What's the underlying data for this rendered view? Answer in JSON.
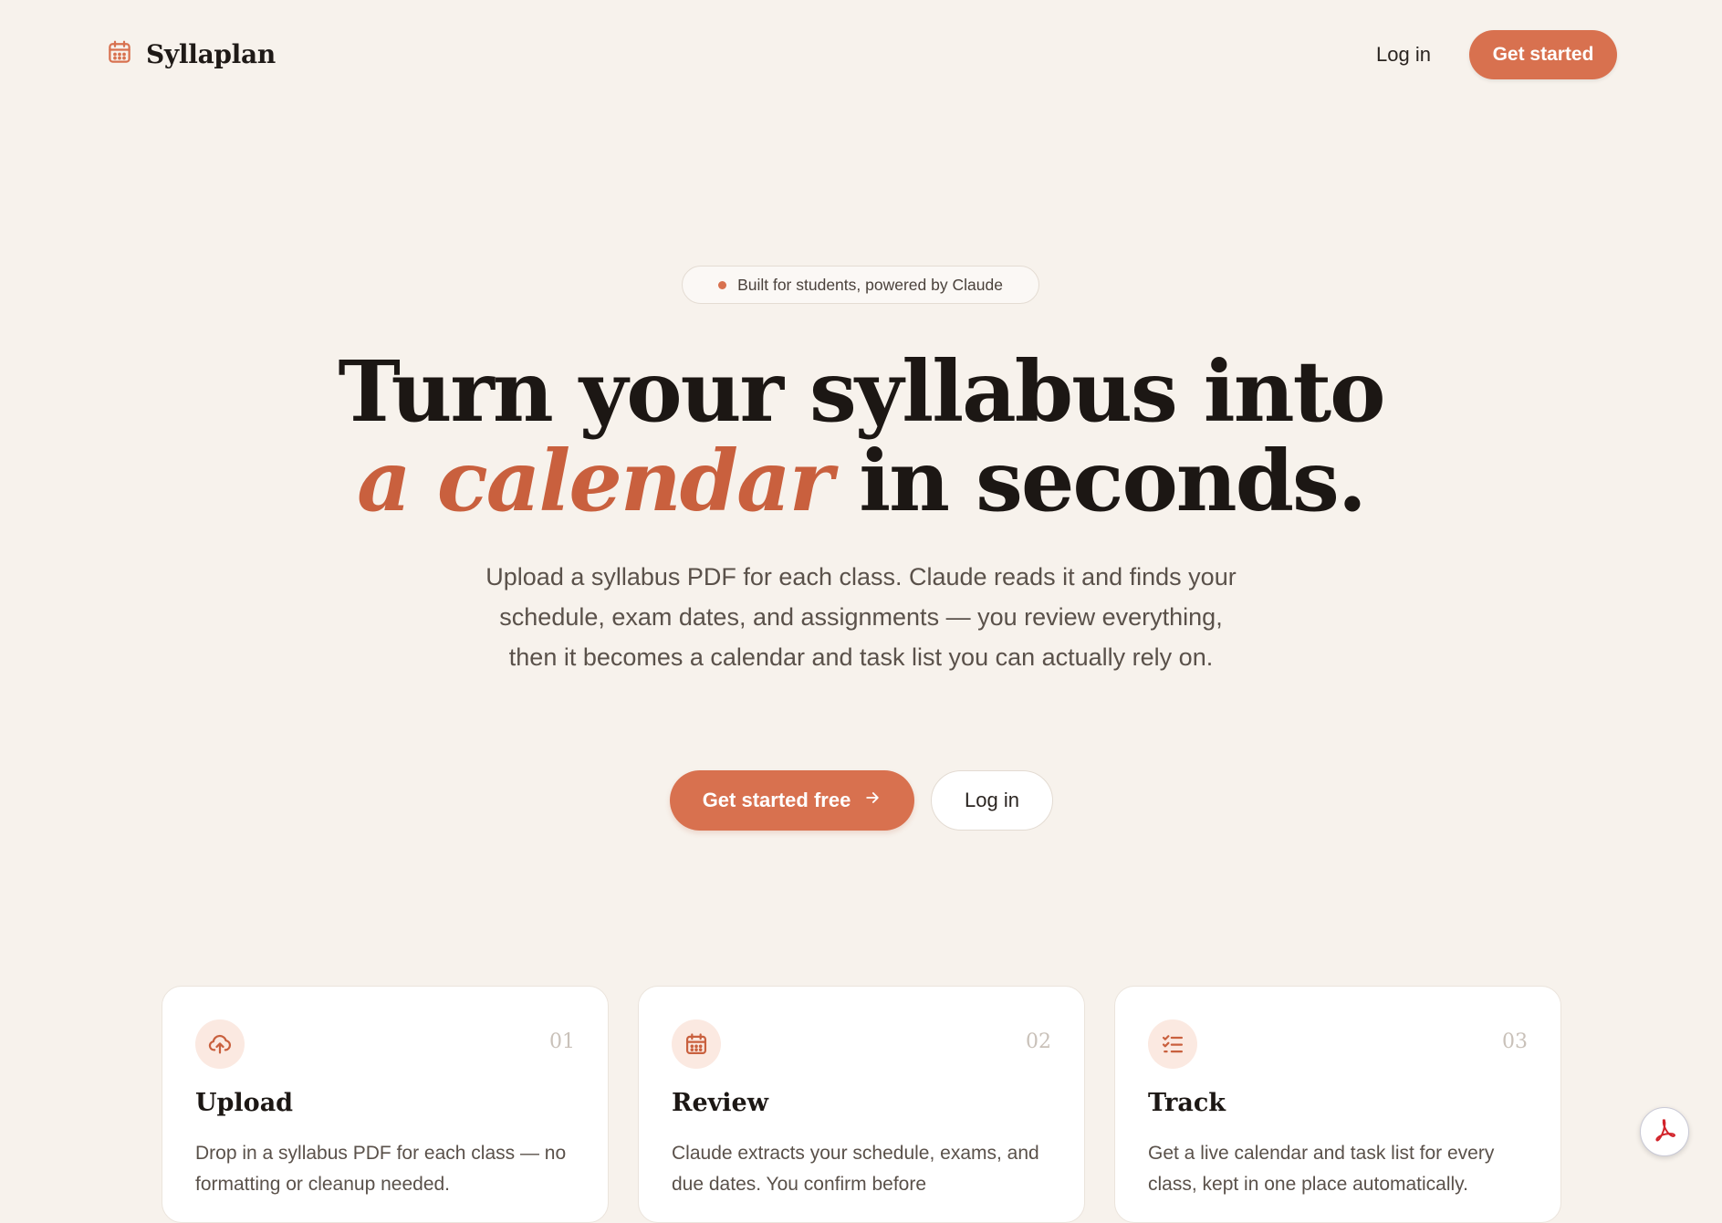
{
  "brand": {
    "name": "Syllaplan",
    "icon": "calendar-icon"
  },
  "nav": {
    "login_label": "Log in",
    "cta_label": "Get started"
  },
  "hero": {
    "pill_text": "Built for students, powered by Claude",
    "headline_line1": "Turn your syllabus into",
    "headline_accent": "a calendar",
    "headline_rest": " in seconds.",
    "subtitle": "Upload a syllabus PDF for each class. Claude reads it and finds your schedule, exam dates, and assignments — you review everything, then it becomes a calendar and task list you can actually rely on.",
    "primary_cta": "Get started free",
    "secondary_cta": "Log in"
  },
  "features": [
    {
      "num": "01",
      "title": "Upload",
      "desc": "Drop in a syllabus PDF for each class — no formatting or cleanup needed.",
      "icon": "cloud-upload-icon"
    },
    {
      "num": "02",
      "title": "Review",
      "desc": "Claude extracts your schedule, exams, and due dates. You confirm before",
      "icon": "calendar-icon"
    },
    {
      "num": "03",
      "title": "Track",
      "desc": "Get a live calendar and task list for every class, kept in one place automatically.",
      "icon": "checklist-icon"
    }
  ],
  "colors": {
    "accent": "#d8714f",
    "background": "#f7f2ec",
    "accent_text": "#c9603e"
  },
  "floating": {
    "icon": "acrobat-pdf-icon"
  }
}
